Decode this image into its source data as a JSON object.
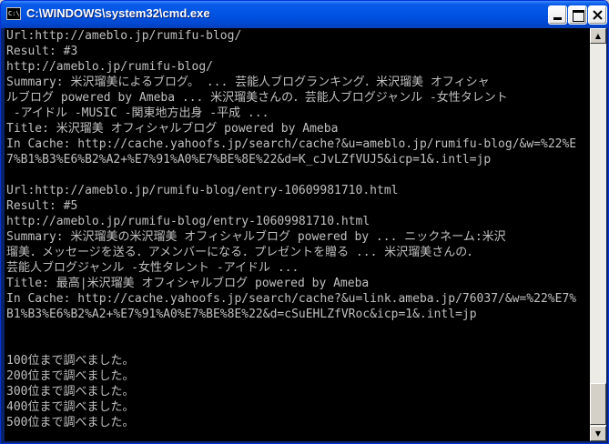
{
  "window": {
    "title": "C:\\WINDOWS\\system32\\cmd.exe",
    "icon_text": "C:\\"
  },
  "console": {
    "lines": [
      "Url:http://ameblo.jp/rumifu-blog/",
      "Result: #3",
      "http://ameblo.jp/rumifu-blog/",
      "Summary: 米沢瑠美によるブログ。 ... 芸能人ブログランキング．米沢瑠美 オフィシャ",
      "ルブログ powered by Ameba ... 米沢瑠美さんの．芸能人ブログジャンル -女性タレント",
      " -アイドル -MUSIC -関東地方出身 -平成 ...",
      "Title: 米沢瑠美 オフィシャルブログ powered by Ameba",
      "In Cache: http://cache.yahoofs.jp/search/cache?&u=ameblo.jp/rumifu-blog/&w=%22%E",
      "7%B1%B3%E6%B2%A2+%E7%91%A0%E7%BE%8E%22&d=K_cJvLZfVUJ5&icp=1&.intl=jp",
      "",
      "Url:http://ameblo.jp/rumifu-blog/entry-10609981710.html",
      "Result: #5",
      "http://ameblo.jp/rumifu-blog/entry-10609981710.html",
      "Summary: 米沢瑠美の米沢瑠美 オフィシャルブログ powered by ... ニックネーム:米沢",
      "瑠美．メッセージを送る．アメンバーになる．プレゼントを贈る ... 米沢瑠美さんの．",
      "芸能人ブログジャンル -女性タレント -アイドル ...",
      "Title: 最高|米沢瑠美 オフィシャルブログ powered by Ameba",
      "In Cache: http://cache.yahoofs.jp/search/cache?&u=link.ameba.jp/76037/&w=%22%E7%",
      "B1%B3%E6%B2%A2+%E7%91%A0%E7%BE%8E%22&d=cSuEHLZfVRoc&icp=1&.intl=jp",
      "",
      "",
      "100位まで調べました。",
      "200位まで調べました。",
      "300位まで調べました。",
      "400位まで調べました。",
      "500位まで調べました。"
    ]
  },
  "colors": {
    "console_bg": "#000000",
    "console_text": "#c0c0c0",
    "titlebar": "#0054e3"
  },
  "icons": {
    "minimize": "minimize-icon",
    "maximize": "maximize-icon",
    "close": "close-icon",
    "scroll_up": "arrow-up-icon",
    "scroll_down": "arrow-down-icon"
  }
}
